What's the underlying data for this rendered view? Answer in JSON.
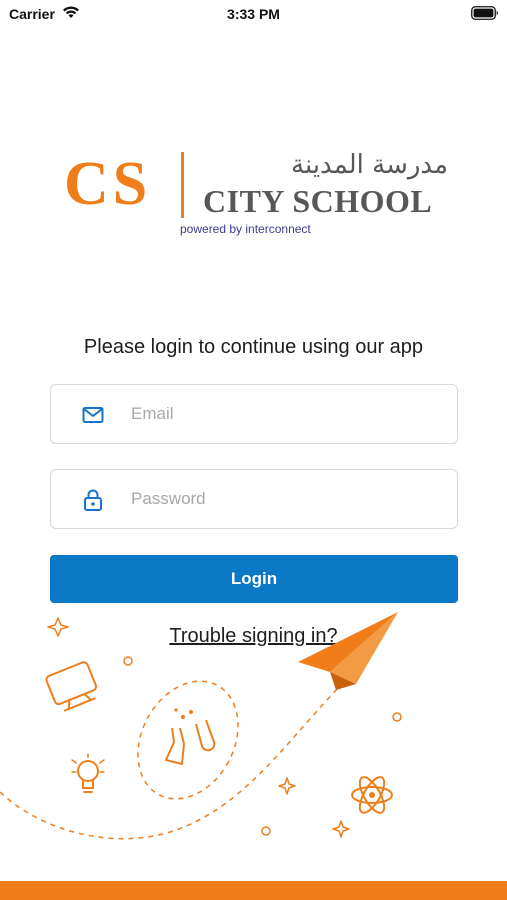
{
  "status_bar": {
    "carrier": "Carrier",
    "time": "3:33 PM"
  },
  "logo": {
    "initials": "CS",
    "arabic_name": "مدرسة المدينة",
    "english_name": "CITY SCHOOL",
    "powered_by": "powered by interconnect"
  },
  "login": {
    "prompt": "Please login to continue using our app",
    "email_placeholder": "Email",
    "password_placeholder": "Password",
    "button_label": "Login",
    "trouble_link": "Trouble signing in?"
  },
  "colors": {
    "brand_orange": "#ef7e1a",
    "button_blue": "#0a78c4",
    "icon_blue": "#1a73c8"
  },
  "icons": {
    "email": "mail-icon",
    "password": "lock-icon",
    "decor": [
      "sparkle-icon",
      "monitor-icon",
      "lightbulb-icon",
      "test-tubes-icon",
      "atom-icon",
      "paper-plane-icon"
    ]
  }
}
